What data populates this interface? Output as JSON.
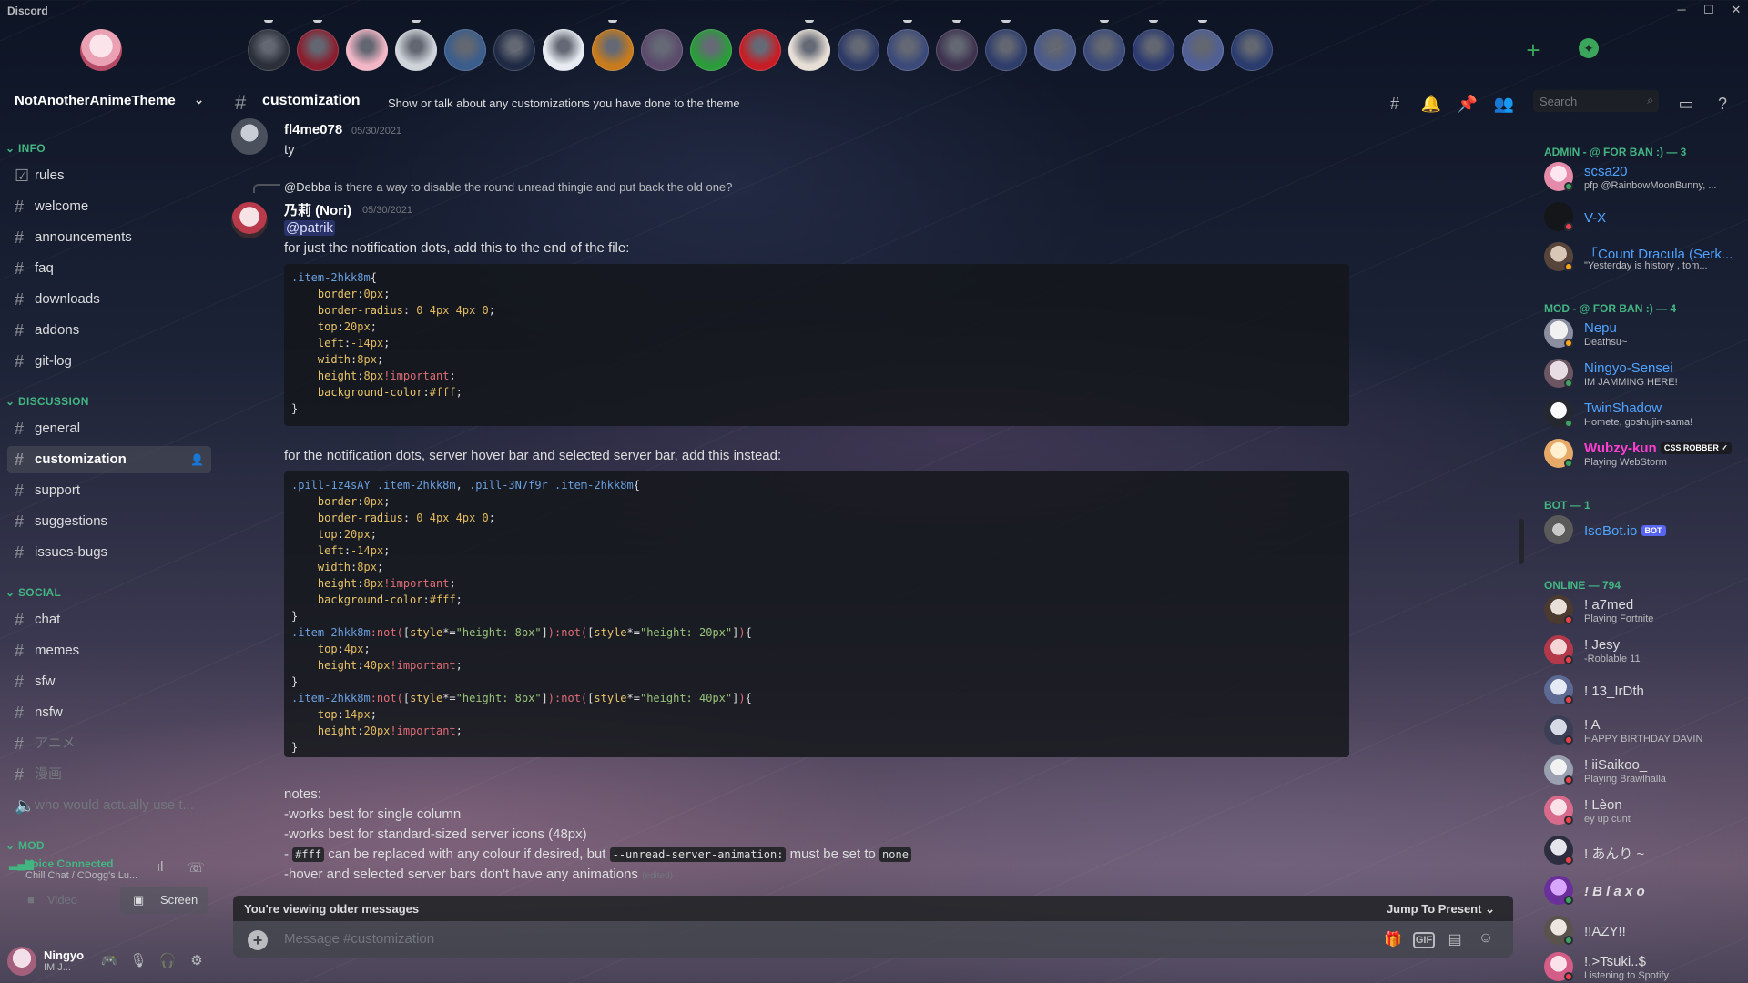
{
  "app": {
    "title": "Discord"
  },
  "window": {
    "min": "─",
    "max": "☐",
    "close": "✕"
  },
  "server_bar": {
    "home_label": "Direct Messages",
    "add_icon": "+",
    "discover_icon": "compass-icon",
    "servers": [
      "s1",
      "s2",
      "s3",
      "s4",
      "s5",
      "s6",
      "s7",
      "s8",
      "s9",
      "s10",
      "s11",
      "s12",
      "s13",
      "s14",
      "s15",
      "s16",
      "s17",
      "s18",
      "s19",
      "s20",
      "s21"
    ]
  },
  "guild": {
    "name": "NotAnotherAnimeTheme",
    "chevron": "⌄"
  },
  "categories": {
    "info": "INFO",
    "discussion": "DISCUSSION",
    "social": "SOCIAL",
    "mod": "MOD"
  },
  "channels": {
    "info": [
      "rules",
      "welcome",
      "announcements",
      "faq",
      "downloads",
      "addons",
      "git-log"
    ],
    "discussion": [
      "general",
      "customization",
      "support",
      "suggestions",
      "issues-bugs"
    ],
    "social": [
      "chat",
      "memes",
      "sfw",
      "nsfw",
      "アニメ",
      "漫画",
      "who would actually use t..."
    ]
  },
  "voice": {
    "status": "Voice Connected",
    "channel": "Chill Chat / CDogg's Lu...",
    "video": "Video",
    "screen": "Screen"
  },
  "user": {
    "name": "Ningyo",
    "tag": "IM J..."
  },
  "header": {
    "channel": "customization",
    "topic": "Show or talk about any customizations you have done to the theme",
    "search_placeholder": "Search"
  },
  "messages": {
    "m1": {
      "author": "fl4me078",
      "time": "05/30/2021",
      "text": "ty"
    },
    "m2": {
      "reply_author": "@Debba",
      "reply_text": "is there a way to disable the round unread thingie and put back the old one?",
      "author": "乃莉 (Nori)",
      "time": "05/30/2021",
      "mention": "@patrik",
      "line1": "for just the notification dots, add this to the end of the file:",
      "line2": "for the notification dots, server hover bar and selected server bar, add this instead:",
      "notes": "notes:",
      "note1": "-works best for single column",
      "note2": "-works best for standard-sized server icons (48px)",
      "note3_code1": "#fff",
      "note3_a": "can be replaced with any colour if desired, but",
      "note3_code2": "--unread-server-animation:",
      "note3_b": "must be set to",
      "note3_code3": "none",
      "note4": "-hover and selected server bars don't have any animations",
      "edited": "(edited)"
    }
  },
  "composer": {
    "older": "You're viewing older messages",
    "jump": "Jump To Present",
    "placeholder": "Message #customization"
  },
  "members": {
    "cat_admin": "ADMIN - @ FOR BAN :) — 3",
    "cat_mod": "MOD - @ FOR BAN :) — 4",
    "cat_bot": "BOT — 1",
    "cat_online": "ONLINE — 794",
    "admin": [
      {
        "name": "scsa20",
        "status": "pfp @RainbowMoonBunny, ..."
      },
      {
        "name": "V-X",
        "status": ""
      },
      {
        "name": "「Count Dracula (Serk...",
        "status": "\"Yesterday is history , tom..."
      }
    ],
    "mod": [
      {
        "name": "Nepu",
        "status": "Deathsu~"
      },
      {
        "name": "Ningyo-Sensei",
        "status": "IM JAMMING HERE!"
      },
      {
        "name": "TwinShadow",
        "status": "Homete, goshujin-sama!"
      },
      {
        "name": "Wubzy-kun",
        "badge": "CSS ROBBER ✓",
        "status": "Playing WebStorm"
      }
    ],
    "bot": [
      {
        "name": "IsoBot.io",
        "badge": "BOT"
      }
    ],
    "online": [
      {
        "name": "! a7med",
        "status": "Playing Fortnite"
      },
      {
        "name": "! Jesy",
        "status": "-Roblable 11"
      },
      {
        "name": "! 13_IrDth",
        "status": ""
      },
      {
        "name": "! A",
        "status": "HAPPY BIRTHDAY DAVIN"
      },
      {
        "name": "! iiSaikoo_",
        "status": "Playing Brawlhalla"
      },
      {
        "name": "! Lèon",
        "status": "ey up cunt"
      },
      {
        "name": "! あんり ~",
        "status": ""
      },
      {
        "name": "! B l a x o",
        "status": ""
      },
      {
        "name": "!!AZY!!",
        "status": ""
      },
      {
        "name": "!.>Tsuki..$",
        "status": "Listening to Spotify"
      }
    ]
  },
  "colors": {
    "accent": "#5865f2",
    "online": "#3ba55c",
    "dnd": "#ed4245",
    "idle": "#faa61a",
    "category": "#43b581"
  }
}
